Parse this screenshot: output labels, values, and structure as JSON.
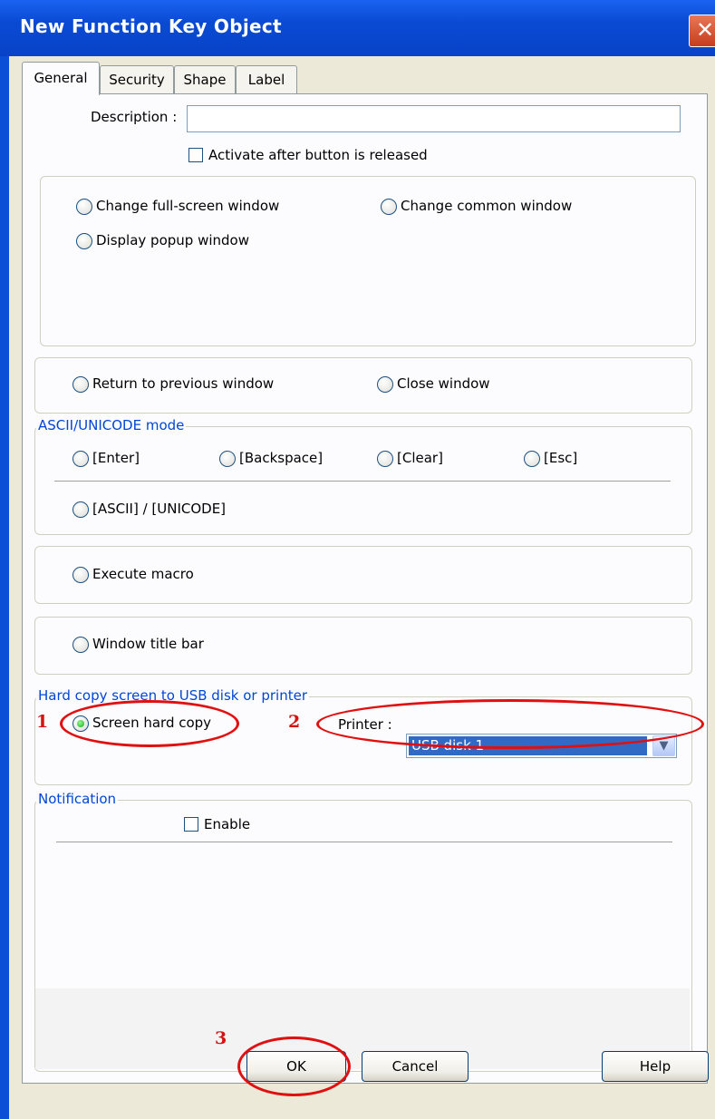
{
  "window": {
    "title": "New  Function Key Object",
    "close_glyph": "✕"
  },
  "tabs": [
    {
      "label": "General",
      "active": true
    },
    {
      "label": "Security",
      "active": false
    },
    {
      "label": "Shape",
      "active": false
    },
    {
      "label": "Label",
      "active": false
    }
  ],
  "general": {
    "description_label": "Description :",
    "description_value": "",
    "activate_after_release_label": "Activate after button is released",
    "activate_after_release_checked": false
  },
  "window_ops": {
    "change_fullscreen": "Change full-screen window",
    "change_common": "Change common window",
    "display_popup": "Display popup window"
  },
  "return_close": {
    "return_previous": "Return to previous window",
    "close_window": "Close window"
  },
  "ascii_group": {
    "legend": "ASCII/UNICODE mode",
    "enter": "[Enter]",
    "backspace": "[Backspace]",
    "clear": "[Clear]",
    "esc": "[Esc]",
    "ascii_unicode": "[ASCII] / [UNICODE]"
  },
  "macro": {
    "execute_macro": "Execute macro"
  },
  "title_bar": {
    "window_title_bar": "Window title bar"
  },
  "hardcopy_group": {
    "legend": "Hard copy screen to USB disk or printer",
    "screen_hard_copy": "Screen hard copy",
    "screen_hard_copy_selected": true,
    "printer_label": "Printer :",
    "printer_value": "USB disk 1"
  },
  "notification_group": {
    "legend": "Notification",
    "enable_label": "Enable",
    "enable_checked": false
  },
  "buttons": {
    "ok": "OK",
    "cancel": "Cancel",
    "help": "Help"
  },
  "annotations": {
    "step1": "1",
    "step2": "2",
    "step3": "3",
    "color": "#e01010"
  },
  "colors": {
    "title_bar": "#0a4ad3",
    "legend_text": "#0046d5",
    "selection": "#316ac5"
  }
}
